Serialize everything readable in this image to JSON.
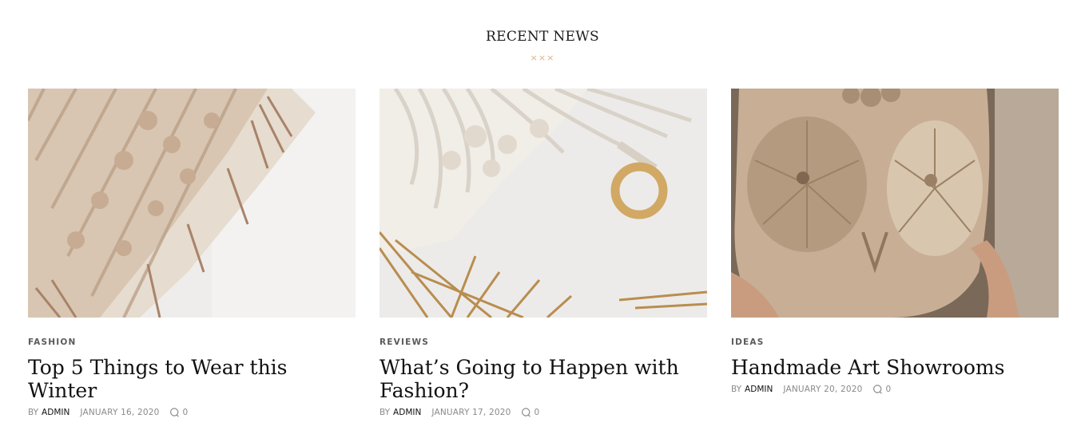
{
  "section": {
    "title": "RECENT NEWS",
    "ornament": "×××"
  },
  "posts": [
    {
      "category": "FASHION",
      "title": "Top 5 Things to Wear this Winter",
      "by": "BY",
      "author": "ADMIN",
      "date": "JANUARY 16, 2020",
      "comments": "0",
      "image_alt": "Crochet pillow with fringe"
    },
    {
      "category": "REVIEWS",
      "title": "What’s Going to Happen with Fashion?",
      "by": "BY",
      "author": "ADMIN",
      "date": "JANUARY 17, 2020",
      "comments": "0",
      "image_alt": "Macrame hanger with wooden ring and dried palm leaves"
    },
    {
      "category": "IDEAS",
      "title": "Handmade Art Showrooms",
      "by": "BY",
      "author": "ADMIN",
      "date": "JANUARY 20, 2020",
      "comments": "0",
      "image_alt": "Ceramic owl held in hands"
    }
  ],
  "colors": {
    "accent": "#d9b08c",
    "text": "#111111",
    "meta": "#8a8a8a"
  }
}
